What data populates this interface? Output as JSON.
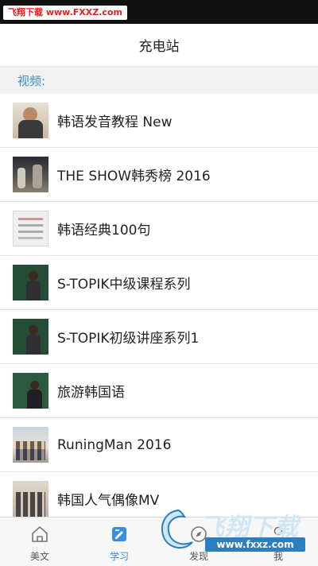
{
  "watermark": {
    "top_label": "飞翔下载 www.FXXZ.com",
    "brand_text": "飞翔下载",
    "site_text": "www.fxxz.com"
  },
  "header": {
    "title": "充电站"
  },
  "section": {
    "label": "视频:"
  },
  "videos": [
    {
      "title": "韩语发音教程 New",
      "thumb": "man-in-suit"
    },
    {
      "title": "THE SHOW韩秀榜 2016",
      "thumb": "stage-performers"
    },
    {
      "title": "韩语经典100句",
      "thumb": "handwritten-page"
    },
    {
      "title": "S-TOPIK中级课程系列",
      "thumb": "teacher-at-blackboard"
    },
    {
      "title": "S-TOPIK初级讲座系列1",
      "thumb": "teacher-at-blackboard"
    },
    {
      "title": "旅游韩国语",
      "thumb": "teacher-at-blackboard"
    },
    {
      "title": "RuningMan 2016",
      "thumb": "group-photo"
    },
    {
      "title": "韩国人气偶像MV",
      "thumb": "idol-group"
    }
  ],
  "tabs": [
    {
      "label": "美文",
      "icon": "home-icon",
      "active": false
    },
    {
      "label": "学习",
      "icon": "study-icon",
      "active": true
    },
    {
      "label": "发现",
      "icon": "discover-icon",
      "active": false
    },
    {
      "label": "我",
      "icon": "profile-icon",
      "active": false
    }
  ],
  "colors": {
    "accent": "#3a8fd8",
    "status_bar": "#111111",
    "section_bg": "#f1f1f1"
  }
}
